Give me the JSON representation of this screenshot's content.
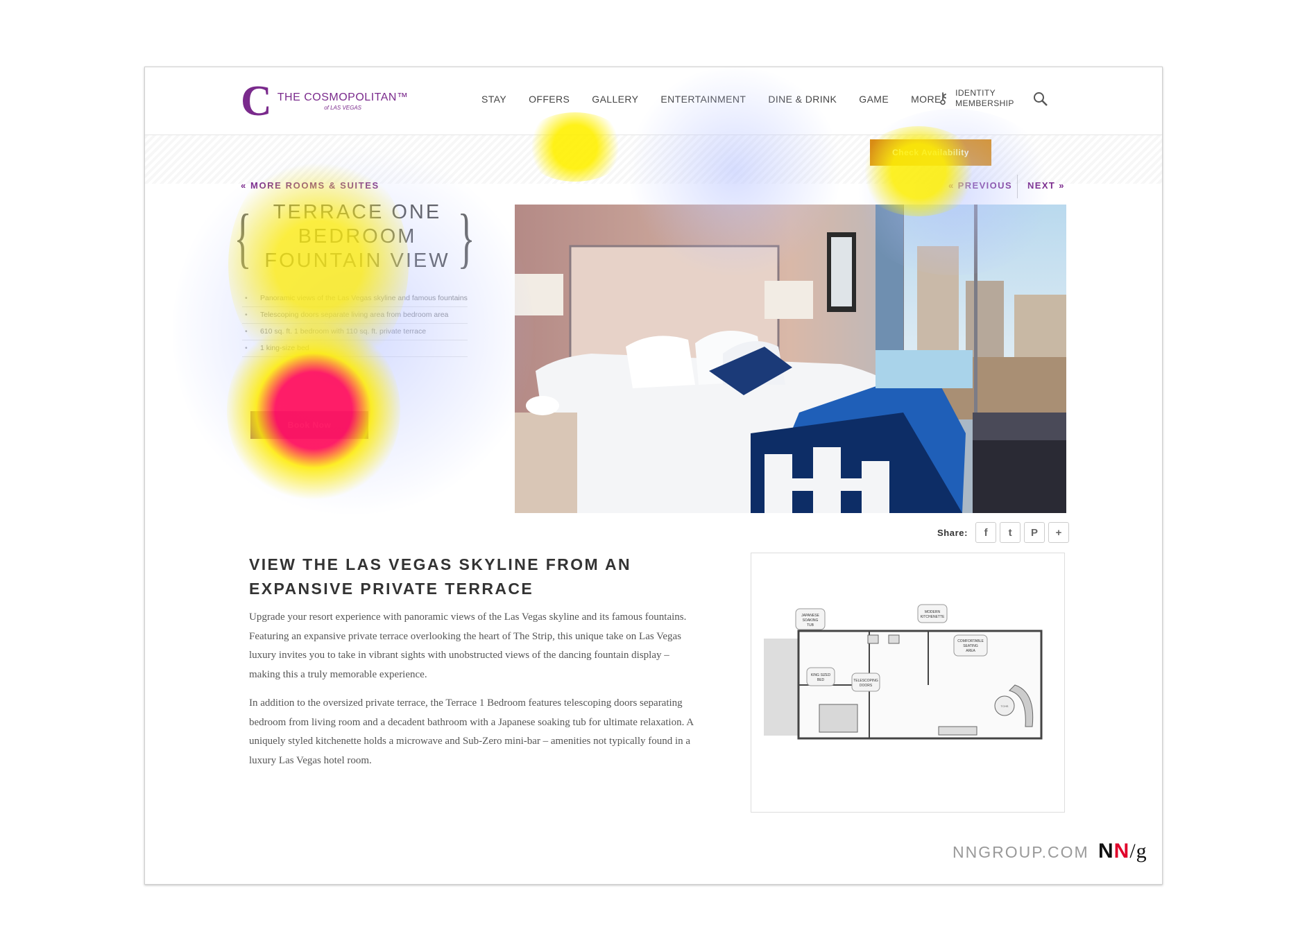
{
  "brand": {
    "name": "THE COSMOPOLITAN™",
    "sub": "of LAS VEGAS",
    "letter": "C"
  },
  "nav": {
    "items": [
      "STAY",
      "OFFERS",
      "GALLERY",
      "ENTERTAINMENT",
      "DINE & DRINK",
      "GAME",
      "MORE"
    ]
  },
  "identity": {
    "line1": "IDENTITY",
    "line2": "MEMBERSHIP"
  },
  "header": {
    "check_availability": "Check Availability"
  },
  "room_nav": {
    "more_rooms": "« MORE ROOMS & SUITES",
    "previous": "« PREVIOUS",
    "next": "NEXT »"
  },
  "room": {
    "title_lines": [
      "TERRACE ONE",
      "BEDROOM",
      "FOUNTAIN VIEW"
    ],
    "features": [
      "Panoramic views of the Las Vegas skyline and famous fountains",
      "Telescoping doors separate living area from bedroom area",
      "610 sq. ft. 1 bedroom with 110 sq. ft. private terrace",
      "1 king-size bed"
    ],
    "book_label": "Book Now"
  },
  "share": {
    "label": "Share:",
    "buttons": [
      "f",
      "t",
      "P",
      "+"
    ]
  },
  "content": {
    "headline_lines": [
      "VIEW THE LAS VEGAS SKYLINE FROM AN",
      "EXPANSIVE PRIVATE TERRACE"
    ],
    "paragraphs": [
      "Upgrade your resort experience with panoramic views of the Las Vegas skyline and its famous fountains. Featuring an expansive private terrace overlooking the heart of The Strip, this unique take on Las Vegas luxury invites you to take in vibrant sights with unobstructed views of the dancing fountain display – making this a truly memorable experience.",
      "In addition to the oversized private terrace, the Terrace 1 Bedroom features telescoping doors separating bedroom from living room and a decadent bathroom with a Japanese soaking tub for ultimate relaxation. A uniquely styled kitchenette holds a microwave and Sub-Zero mini-bar – amenities not typically found in a luxury Las Vegas hotel room."
    ]
  },
  "floorplan": {
    "labels": {
      "tub": [
        "JAPANESE",
        "SOAKING",
        "TUB"
      ],
      "kitchen": [
        "MODERN",
        "KITCHENETTE"
      ],
      "seating": [
        "COMFORTABLE",
        "SEATING",
        "AREA"
      ],
      "bed": [
        "KING SIZED",
        "BED"
      ],
      "doors": [
        "TELESCOPING",
        "DOORS"
      ],
      "table": "TCHS"
    }
  },
  "footer": {
    "url": "NNGROUP.COM",
    "logo_n1": "N",
    "logo_n2": "N",
    "logo_g": "/g"
  },
  "colors": {
    "brand_purple": "#7a2a8c",
    "nng_red": "#e0002a",
    "heat_low": "#b7c3ff",
    "heat_mid": "#ffec00",
    "heat_high": "#ff1060"
  },
  "icons": [
    "key-icon",
    "search-icon",
    "facebook-icon",
    "twitter-icon",
    "pinterest-icon",
    "plus-icon"
  ]
}
